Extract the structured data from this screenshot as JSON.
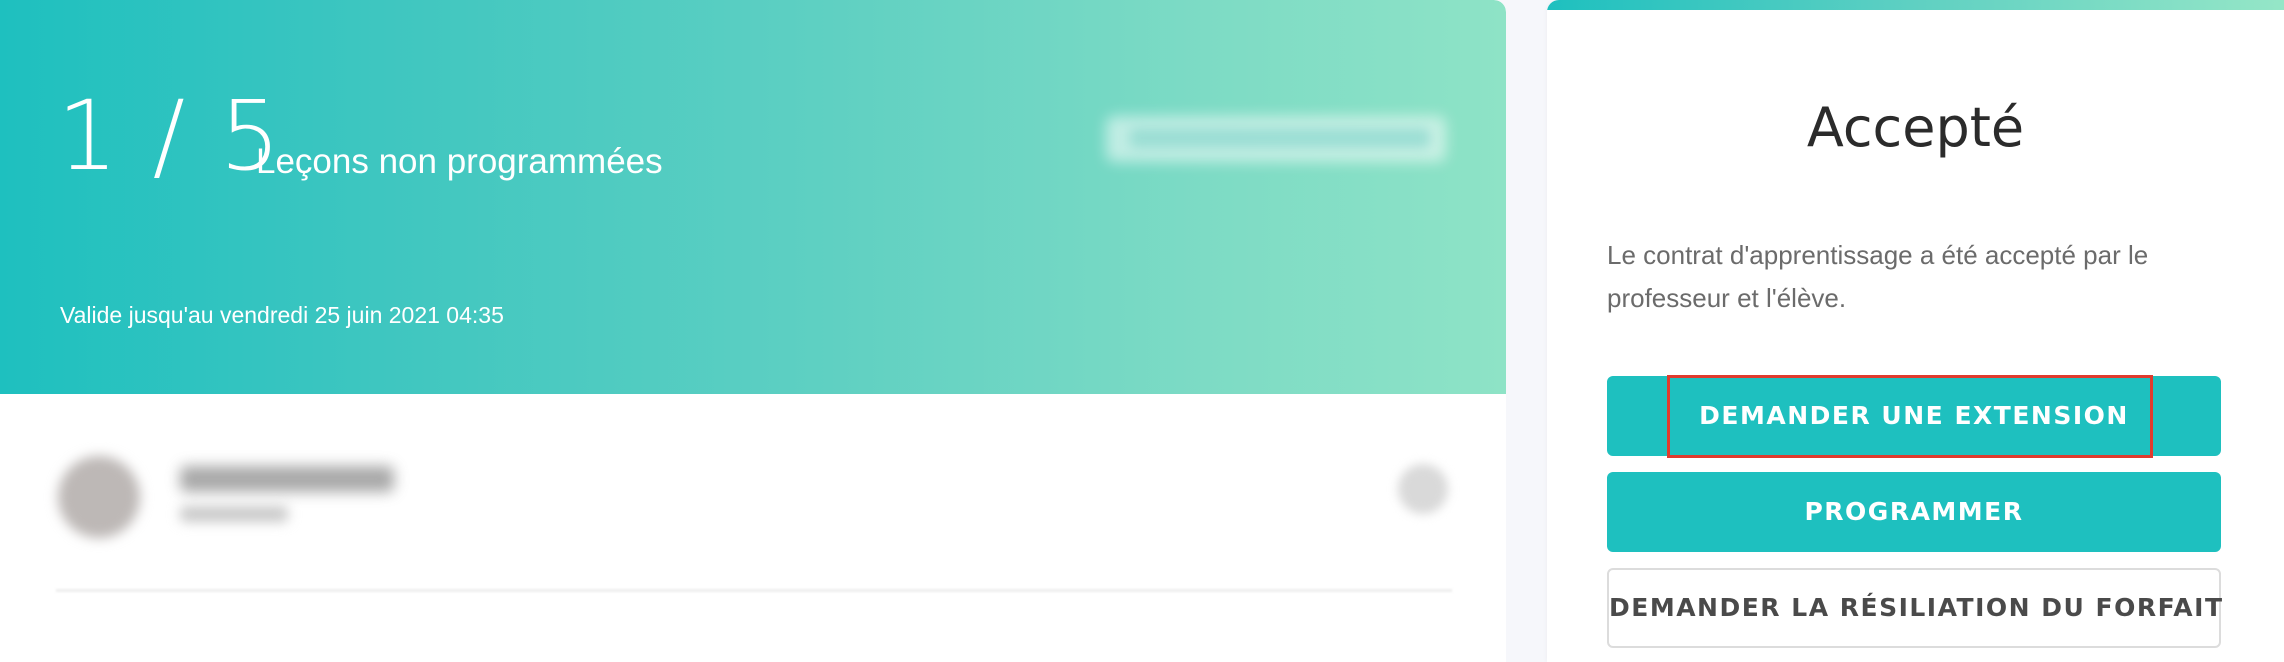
{
  "hero": {
    "lesson_count": "1 / 5",
    "lesson_label": "Leçons non programmées",
    "validity_prefix": "Valide jusqu'au ",
    "validity_date": "vendredi 25 juin 2021 04:35",
    "badge_blurred": true,
    "gradient_colors": [
      "#1ec0bf",
      "#8ee3c6"
    ]
  },
  "teacher": {
    "name": "Teacher Desiree",
    "role": "Professeur",
    "blurred": true
  },
  "contract": {
    "status_title": "Accepté",
    "description": "Le contrat d'apprentissage a été accepté par le professeur et l'élève.",
    "buttons": {
      "extension": "DEMANDER UNE EXTENSION",
      "schedule": "PROGRAMMER",
      "cancel": "DEMANDER LA RÉSILIATION DU FORFAIT"
    }
  },
  "colors": {
    "accent": "#1ec0bf",
    "highlight": "#e03b2e"
  }
}
